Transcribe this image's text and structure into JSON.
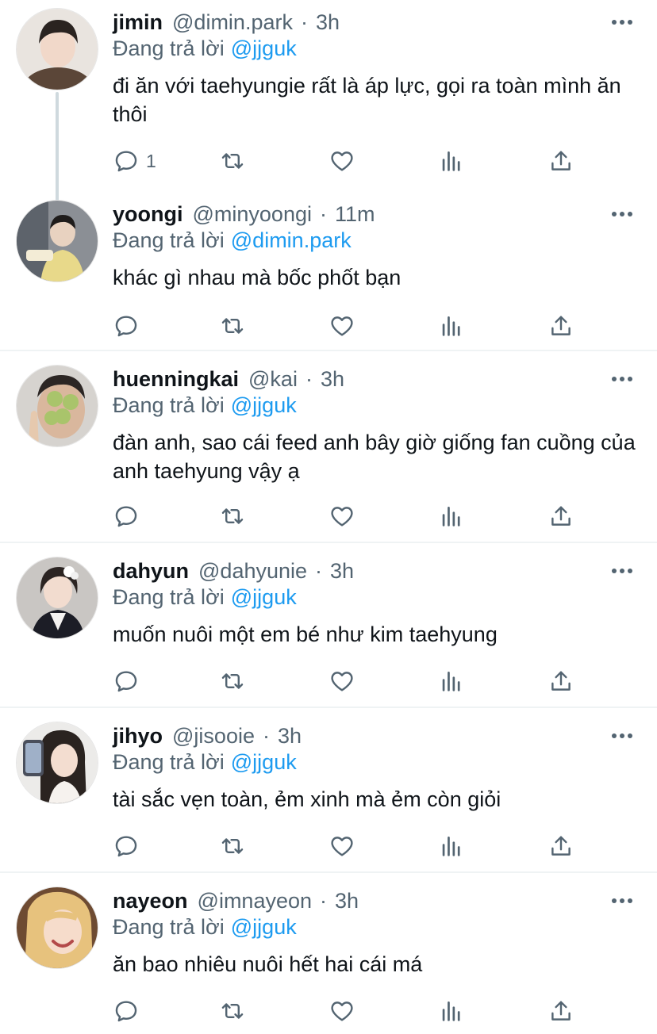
{
  "reply_prefix": "Đang trả lời",
  "accent": "#1d9bf0",
  "tweets": [
    {
      "name": "jimin",
      "handle": "@dimin.park",
      "time": "3h",
      "reply_to": "@jjguk",
      "text": "đi ăn với taehyungie rất là áp lực, gọi ra toàn mình ăn thôi",
      "reply_count": "1"
    },
    {
      "name": "yoongi",
      "handle": "@minyoongi",
      "time": "11m",
      "reply_to": "@dimin.park",
      "text": "khác gì nhau mà bốc phốt bạn",
      "reply_count": ""
    },
    {
      "name": "huenningkai",
      "handle": "@kai",
      "time": "3h",
      "reply_to": "@jjguk",
      "text": "đàn anh, sao cái feed anh bây giờ giống fan cuồng của anh taehyung vậy ạ",
      "reply_count": ""
    },
    {
      "name": "dahyun",
      "handle": "@dahyunie",
      "time": "3h",
      "reply_to": "@jjguk",
      "text": "muốn nuôi một em bé như kim taehyung",
      "reply_count": ""
    },
    {
      "name": "jihyo",
      "handle": "@jisooie",
      "time": "3h",
      "reply_to": "@jjguk",
      "text": "tài sắc vẹn toàn, ẻm xinh mà ẻm còn giỏi",
      "reply_count": ""
    },
    {
      "name": "nayeon",
      "handle": "@imnayeon",
      "time": "3h",
      "reply_to": "@jjguk",
      "text": "ăn bao nhiêu nuôi hết hai cái má",
      "reply_count": ""
    }
  ],
  "dot": "·"
}
